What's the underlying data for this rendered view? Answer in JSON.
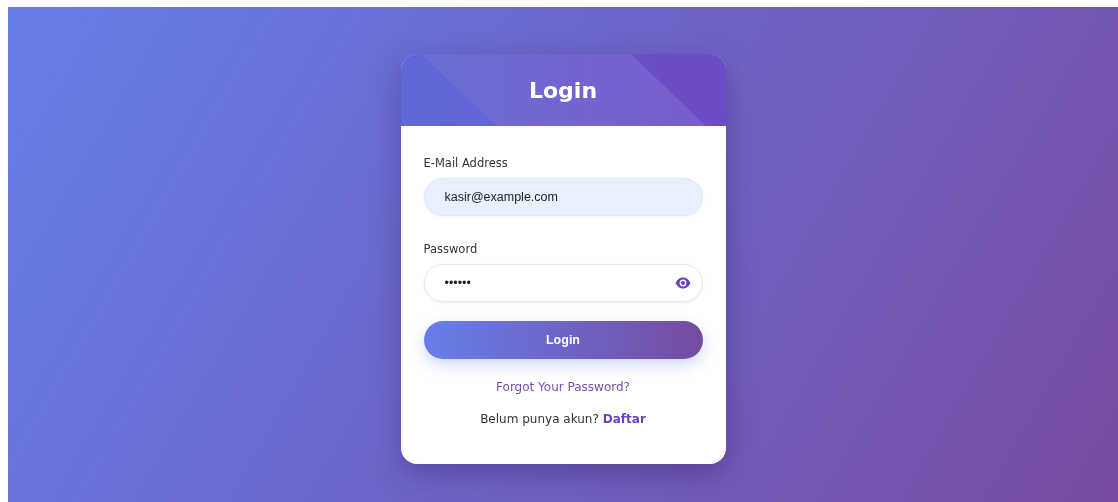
{
  "card": {
    "title": "Login"
  },
  "fields": [
    {
      "label": "E-Mail Address",
      "value": "kasir@example.com",
      "kind": "email",
      "autofilled": true
    },
    {
      "label": "Password",
      "value": "••••••",
      "kind": "password",
      "autofilled": false
    }
  ],
  "submit": "Login",
  "forgot_link": "Forgot Your Password?",
  "signup": {
    "text": "Belum punya akun?",
    "link": "Daftar"
  }
}
